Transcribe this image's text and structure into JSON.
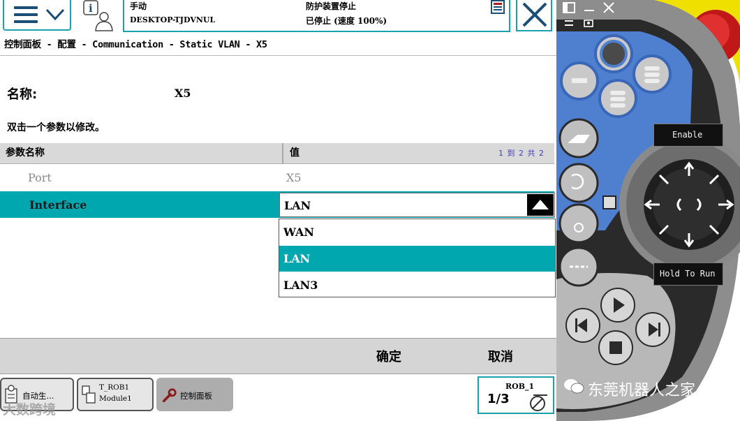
{
  "status_bar": {
    "mode": "手动",
    "controller": "DESKTOP-TJDVNUL",
    "safety": "防护装置停止",
    "state": "已停止 (速度 100%)"
  },
  "breadcrumb": "控制面板 - 配置 - Communication - Static VLAN - X5",
  "name_label": "名称:",
  "name_value": "X5",
  "instruction": "双击一个参数以修改。",
  "table": {
    "col_name": "参数名称",
    "col_value": "值",
    "page_info": "1 到 2 共 2",
    "rows": [
      {
        "name": "Port",
        "value": "X5"
      },
      {
        "name": "Interface",
        "value": "LAN"
      }
    ]
  },
  "dropdown": {
    "selected": "LAN",
    "options": [
      "WAN",
      "LAN",
      "LAN3"
    ]
  },
  "actions": {
    "ok": "确定",
    "cancel": "取消"
  },
  "taskbar": {
    "auto": "自动生...",
    "trob_line1": "T_ROB1",
    "trob_line2": "Module1",
    "control_panel": "控制面板"
  },
  "robot_status": {
    "name": "ROB_1",
    "fraction": "1/3"
  },
  "pendant": {
    "enable_label": "Enable",
    "hold_to_run_label": "Hold To Run"
  },
  "watermarks": {
    "left": "大数跨境",
    "right": "东莞机器人之家"
  },
  "colors": {
    "accent_teal": "#00a7ae",
    "frame_teal": "#1aa1b0",
    "pendant_blue": "#4f7fcf",
    "pendant_yellow": "#f0e000",
    "estop_red": "#d42020"
  },
  "icons": [
    "menu-icon",
    "chevron-down-icon",
    "operator-info-icon",
    "status-doc-icon",
    "close-icon",
    "arrow-up-icon",
    "auto-producer-icon",
    "program-module-icon",
    "wrench-icon",
    "rob-status-icon"
  ]
}
